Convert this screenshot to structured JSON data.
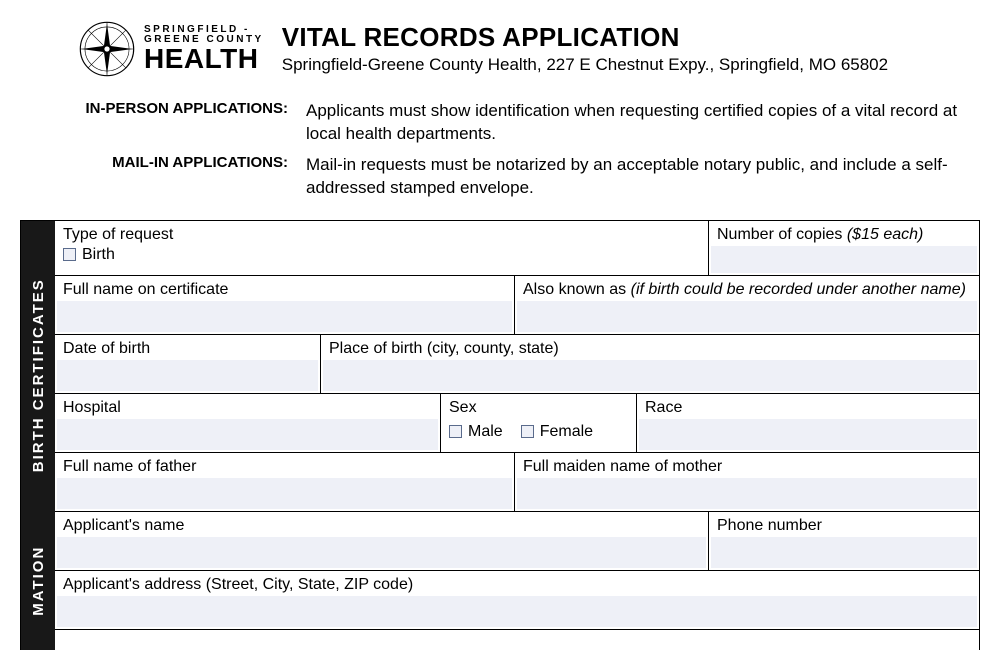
{
  "brand": {
    "line1": "SPRINGFIELD -",
    "line2": "GREENE COUNTY",
    "health": "HEALTH"
  },
  "title": "VITAL RECORDS APPLICATION",
  "subtitle": "Springfield-Greene County Health, 227 E Chestnut Expy., Springfield, MO 65802",
  "info": {
    "inperson_label": "IN-PERSON APPLICATIONS:",
    "inperson_text": "Applicants must show identification when requesting certified copies of a vital record at local health departments.",
    "mailin_label": "MAIL-IN APPLICATIONS:",
    "mailin_text": "Mail-in requests must be notarized by an acceptable notary public, and include a self-addressed stamped envelope."
  },
  "sections": {
    "birth": "BIRTH  CERTIFICATES",
    "info2": "MATION"
  },
  "fields": {
    "type_of_request": "Type of request",
    "birth_option": "Birth",
    "num_copies": "Number of copies",
    "num_copies_hint": "($15 each)",
    "full_name_cert": "Full name on certificate",
    "aka": "Also known as",
    "aka_hint": "(if birth could be recorded under another name)",
    "dob": "Date of birth",
    "pob": "Place of birth (city, county, state)",
    "hospital": "Hospital",
    "sex": "Sex",
    "male": "Male",
    "female": "Female",
    "race": "Race",
    "father": "Full name of father",
    "mother": "Full maiden name of mother",
    "applicant_name": "Applicant's name",
    "phone": "Phone number",
    "applicant_addr": "Applicant's address (Street, City, State, ZIP code)"
  }
}
